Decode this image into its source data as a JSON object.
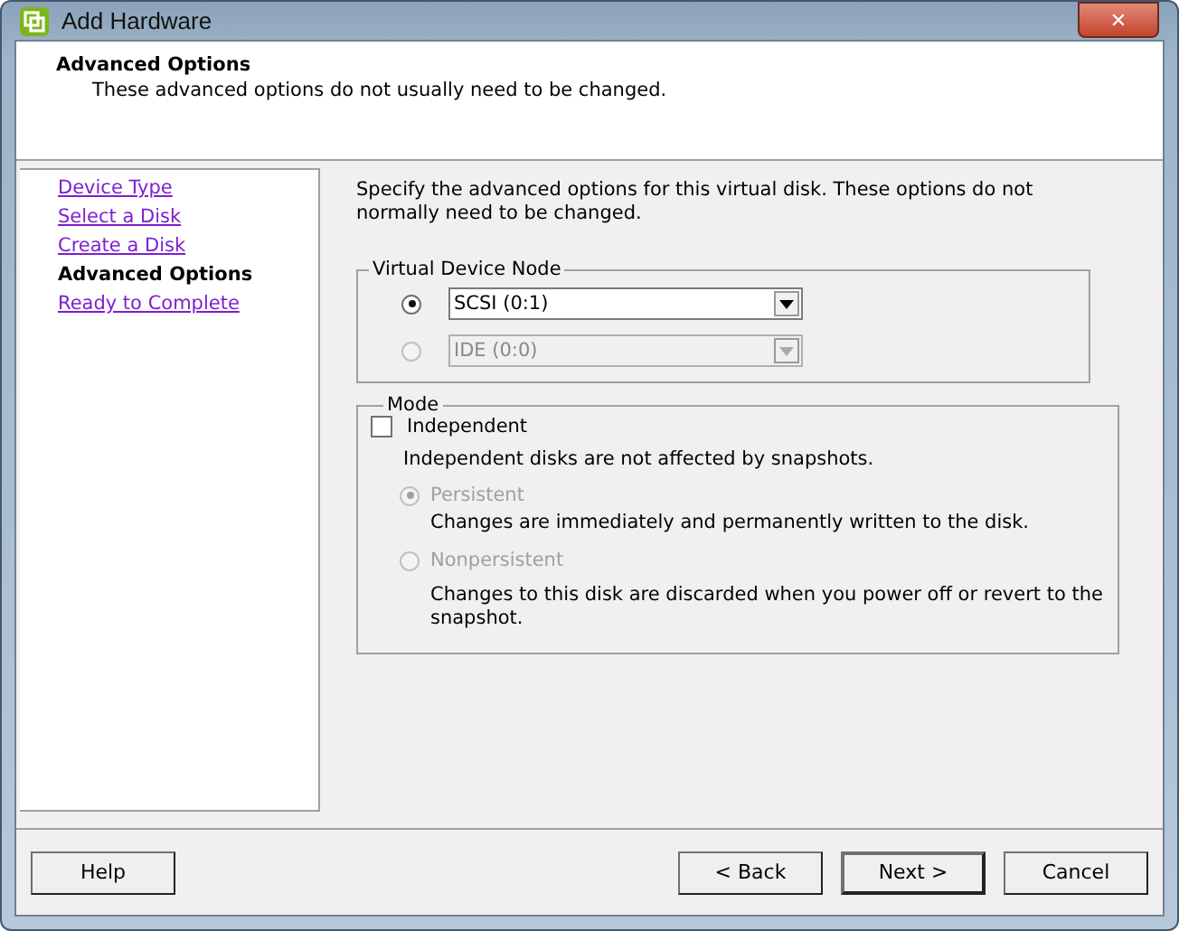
{
  "window": {
    "title": "Add Hardware",
    "close": "✕"
  },
  "header": {
    "title": "Advanced Options",
    "subtitle": "These advanced options do not usually need to be changed."
  },
  "sidebar": {
    "items": [
      {
        "label": "Device Type",
        "selected": false
      },
      {
        "label": "Select a Disk",
        "selected": false
      },
      {
        "label": "Create a Disk",
        "selected": false
      },
      {
        "label": "Advanced Options",
        "selected": true
      },
      {
        "label": "Ready to Complete",
        "selected": false
      }
    ]
  },
  "intro": "Specify the advanced options for this virtual disk. These options do not normally need to be changed.",
  "device_node": {
    "legend": "Virtual Device Node",
    "options": [
      {
        "value": "SCSI (0:1)",
        "selected": true,
        "disabled": false
      },
      {
        "value": "IDE (0:0)",
        "selected": false,
        "disabled": true
      }
    ]
  },
  "mode": {
    "legend": "Mode",
    "independent": {
      "label": "Independent",
      "checked": false
    },
    "note": "Independent disks are not affected by snapshots.",
    "options": [
      {
        "label": "Persistent",
        "selected": true,
        "disabled": true,
        "description": "Changes are immediately and permanently written to the disk."
      },
      {
        "label": "Nonpersistent",
        "selected": false,
        "disabled": true,
        "description": "Changes to this disk are discarded when you power off or revert to the snapshot."
      }
    ]
  },
  "buttons": {
    "help": "Help",
    "back": "< Back",
    "next": "Next >",
    "cancel": "Cancel"
  }
}
